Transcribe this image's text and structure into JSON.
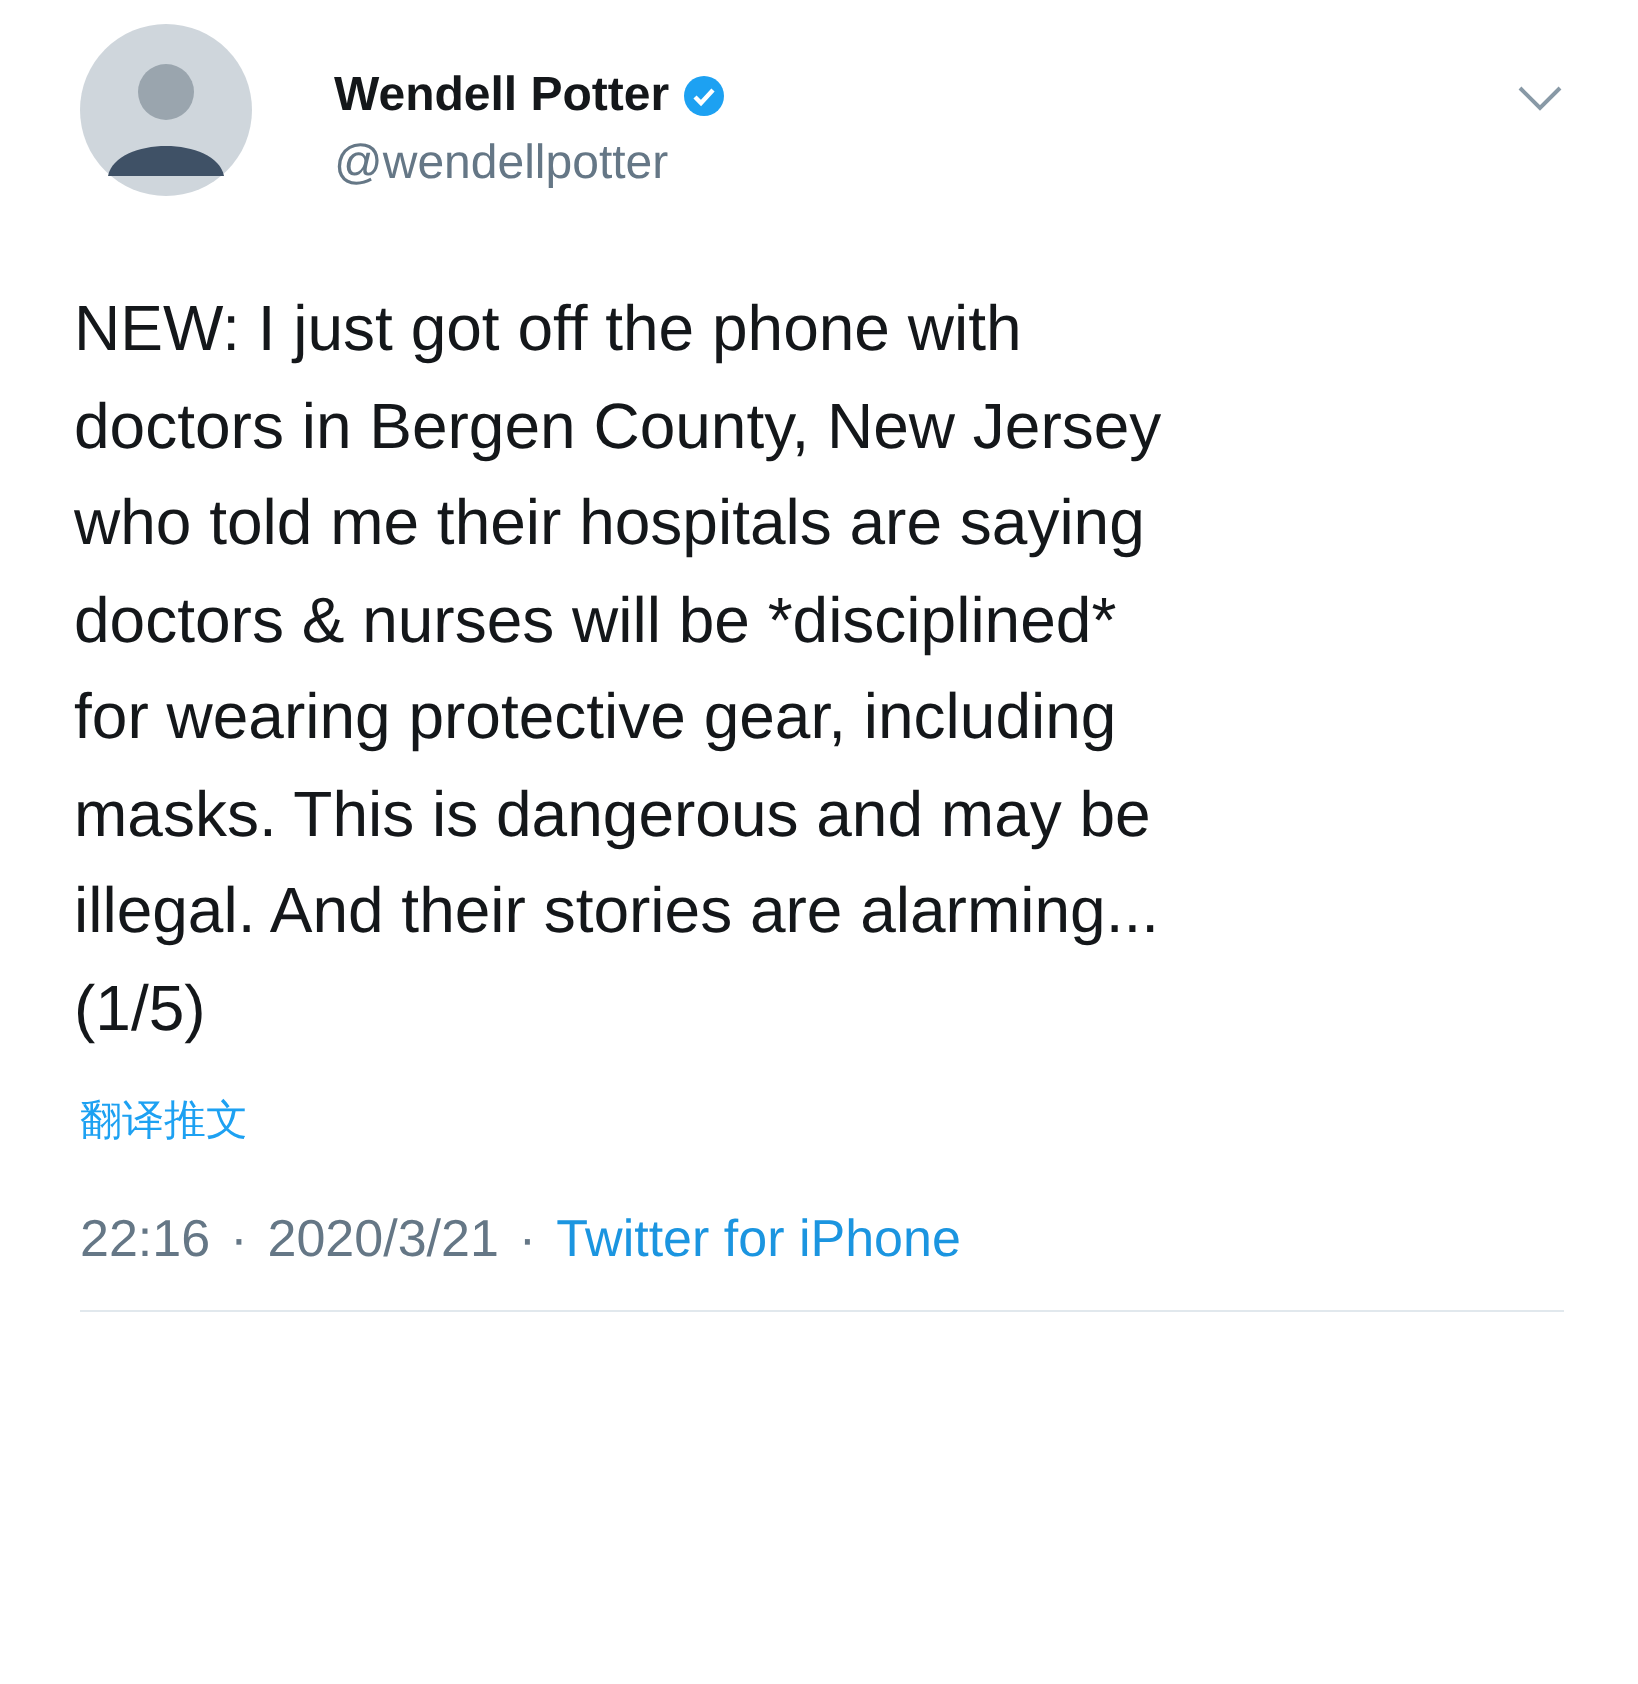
{
  "author": {
    "name": "Wendell Potter",
    "verified": true,
    "handle": "@wendellpotter"
  },
  "tweet": {
    "text": "NEW: I just got off the phone with\ndoctors in Bergen County, New Jersey\nwho told me their hospitals are saying\ndoctors & nurses will be *disciplined*\nfor wearing protective gear, including\nmasks. This is dangerous and may be\nillegal. And their stories are alarming...\n(1/5)"
  },
  "translate_link": "翻译推文",
  "meta": [
    {
      "kind": "text",
      "value": "22:16"
    },
    {
      "kind": "separator",
      "value": "·"
    },
    {
      "kind": "text",
      "value": "2020/3/21"
    },
    {
      "kind": "separator",
      "value": "·"
    },
    {
      "kind": "link",
      "value": "Twitter for iPhone"
    }
  ]
}
